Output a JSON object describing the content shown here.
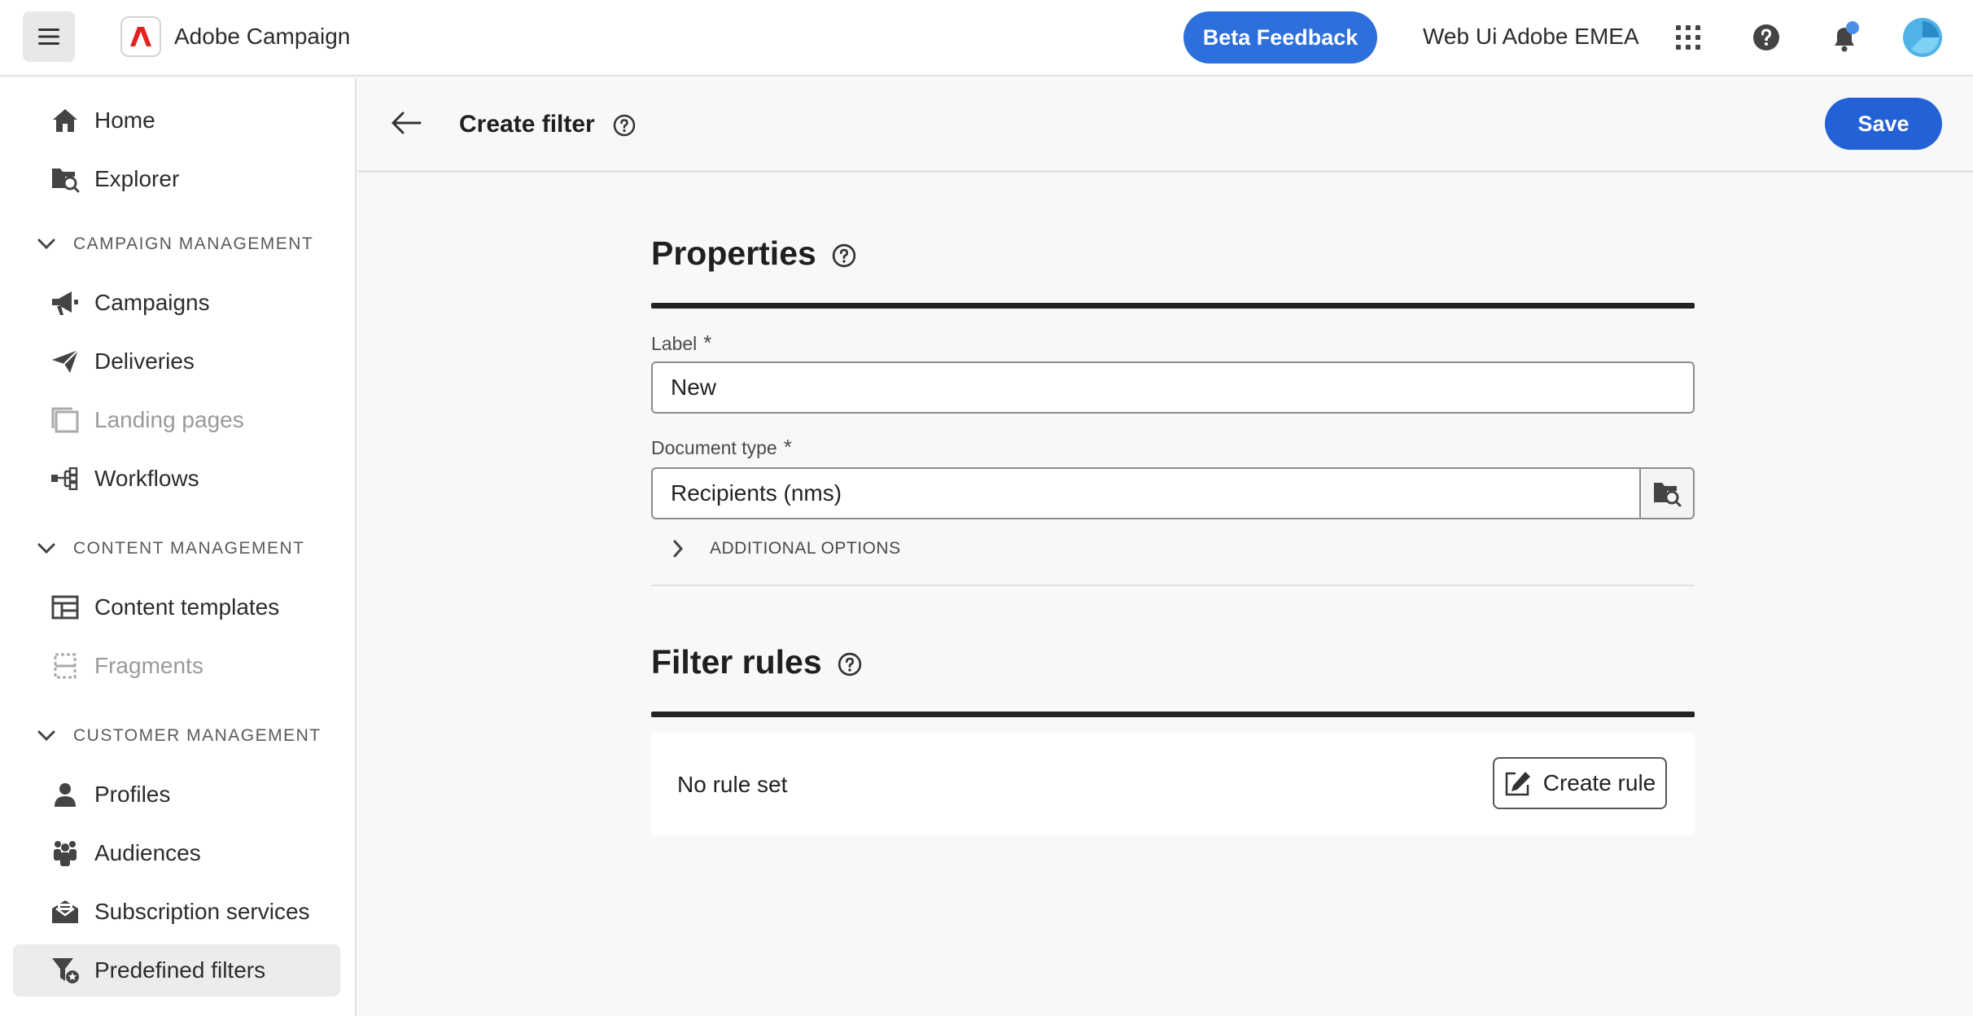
{
  "topbar": {
    "menu_icon": "hamburger-icon",
    "app_name": "Adobe Campaign",
    "beta_feedback": "Beta Feedback",
    "org_name": "Web Ui Adobe EMEA",
    "brand_color": "#e42222",
    "accent_color": "#2d6fdb"
  },
  "sidebar": {
    "home": "Home",
    "explorer": "Explorer",
    "section_campaign": "CAMPAIGN MANAGEMENT",
    "campaigns": "Campaigns",
    "deliveries": "Deliveries",
    "landing_pages": "Landing pages",
    "workflows": "Workflows",
    "section_content": "CONTENT MANAGEMENT",
    "content_templates": "Content templates",
    "fragments": "Fragments",
    "section_customer": "CUSTOMER MANAGEMENT",
    "profiles": "Profiles",
    "audiences": "Audiences",
    "subscription_services": "Subscription services",
    "predefined_filters": "Predefined filters"
  },
  "header": {
    "title": "Create filter",
    "save": "Save"
  },
  "properties": {
    "title": "Properties",
    "label_field": "Label",
    "label_value": "New",
    "doctype_field": "Document type",
    "doctype_value": "Recipients (nms)",
    "additional_options": "ADDITIONAL OPTIONS",
    "required_mark": "*"
  },
  "filter_rules": {
    "title": "Filter rules",
    "empty_text": "No rule set",
    "create_rule": "Create rule"
  }
}
